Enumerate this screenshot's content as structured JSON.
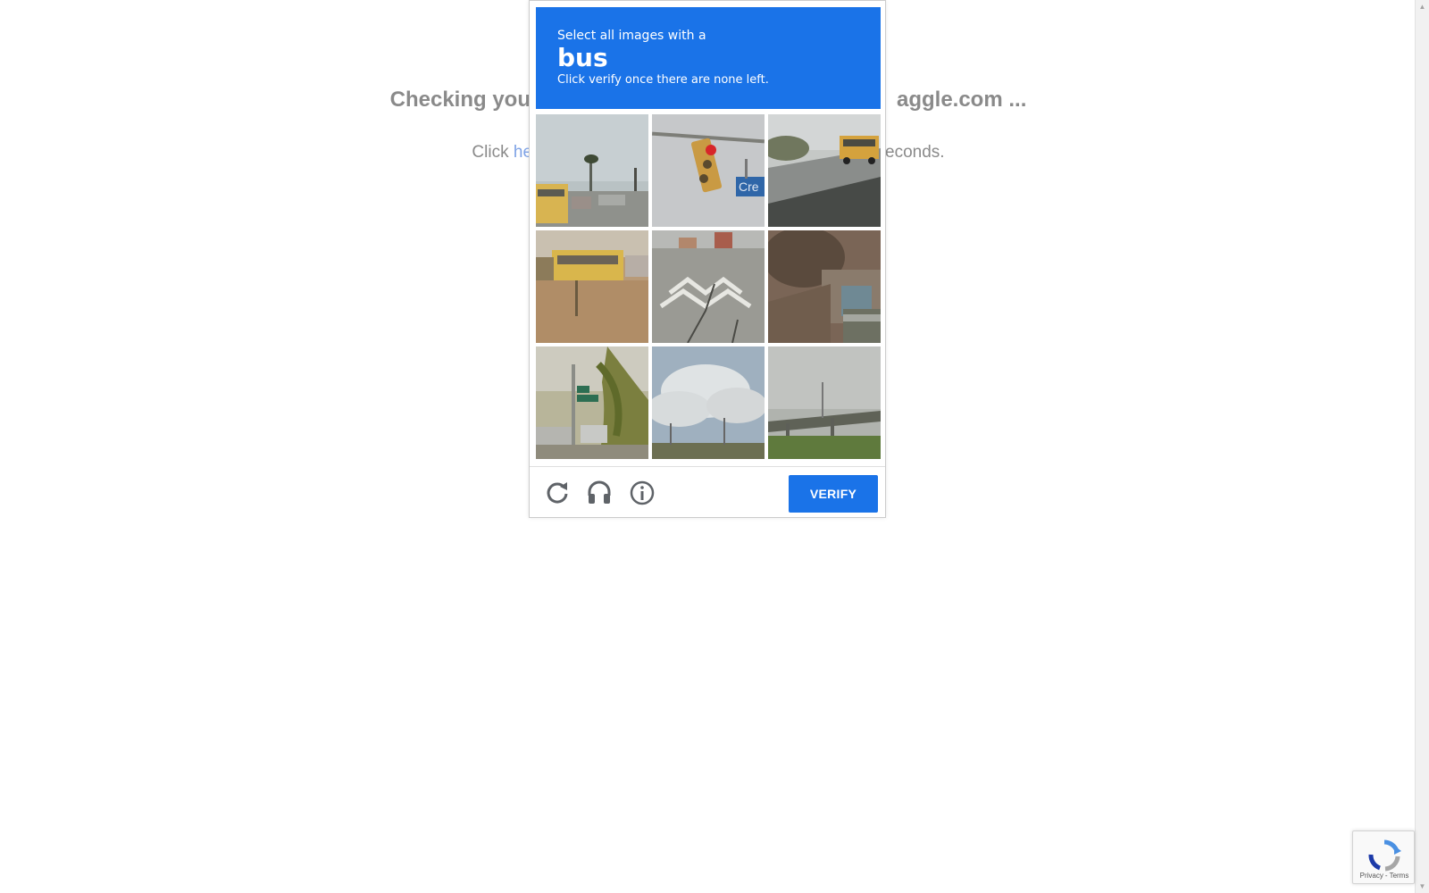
{
  "background": {
    "heading_left": "Checking you",
    "heading_right": "aggle.com ...",
    "sub_prefix": "Click ",
    "sub_link": "he",
    "sub_suffix": "econds."
  },
  "captcha": {
    "instruction_line1": "Select all images with a",
    "target": "bus",
    "instruction_line3": "Click verify once there are none left.",
    "tiles": [
      {
        "index": 1,
        "description": "street-with-school-bus"
      },
      {
        "index": 2,
        "description": "traffic-light-street-sign"
      },
      {
        "index": 3,
        "description": "school-bus-on-road"
      },
      {
        "index": 4,
        "description": "school-bus-behind-grass"
      },
      {
        "index": 5,
        "description": "road-crosswalk"
      },
      {
        "index": 6,
        "description": "building-and-bushes"
      },
      {
        "index": 7,
        "description": "palm-tree-street"
      },
      {
        "index": 8,
        "description": "sky-clouds"
      },
      {
        "index": 9,
        "description": "highway-overpass"
      }
    ],
    "footer": {
      "reload_icon": "reload-icon",
      "audio_icon": "headphones-icon",
      "info_icon": "info-icon",
      "verify_label": "VERIFY"
    },
    "colors": {
      "accent": "#1a73e8"
    }
  },
  "badge": {
    "privacy": "Privacy",
    "separator": "-",
    "terms": "Terms"
  }
}
